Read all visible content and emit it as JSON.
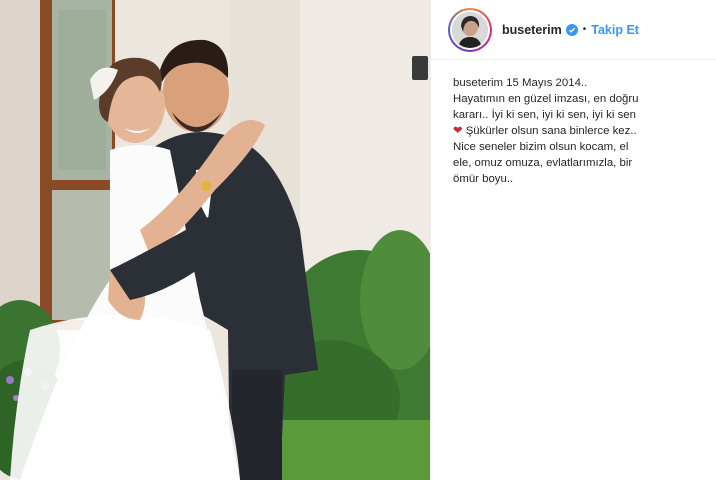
{
  "post": {
    "username": "buseterim",
    "follow_label": "Takip Et",
    "separator": "•",
    "caption_user": "buseterim",
    "caption_part1": " 15 Mayıs 2014.. Hayatımın en güzel imzası, en doğru kararı.. İyi ki sen, iyi ki sen, iyi ki sen",
    "caption_heart": "❤",
    "caption_part2": " Şükürler olsun sana binlerce kez.. Nice seneler bizim olsun kocam, el ele, omuz omuza, evlatlarımızla, bir ömür boyu.."
  },
  "colors": {
    "link_blue": "#3897f0",
    "heart_red": "#c72e3a"
  },
  "icons": {
    "verified": "verified-badge-icon"
  }
}
